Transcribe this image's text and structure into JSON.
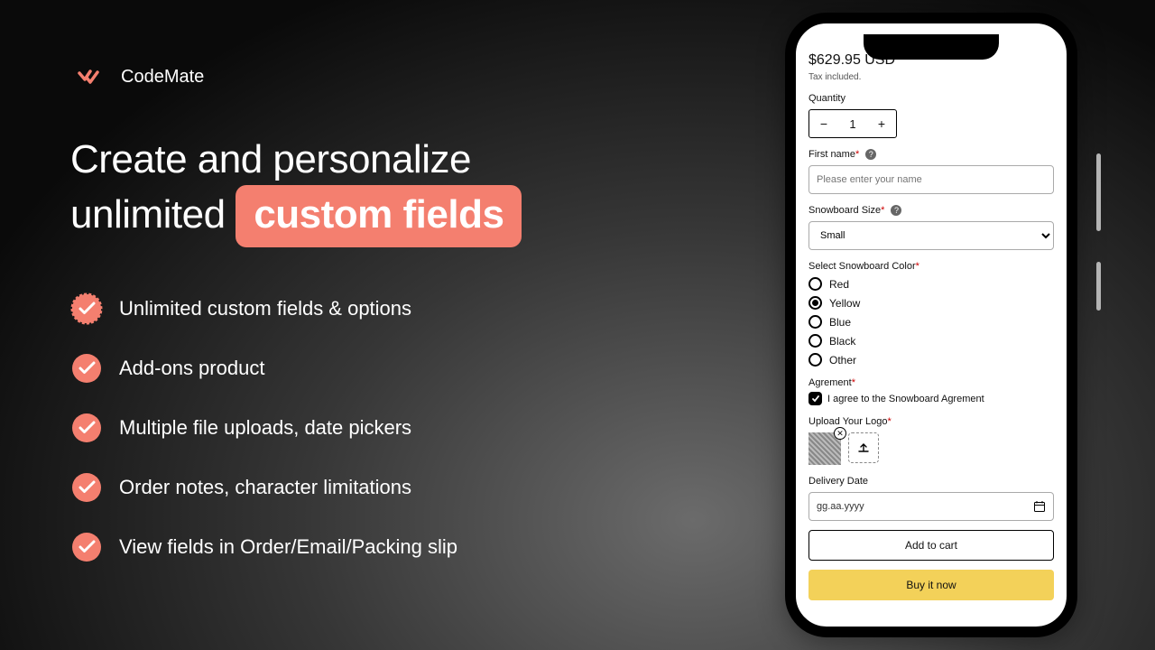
{
  "brand": {
    "name": "CodeMate"
  },
  "headline": {
    "line1": "Create and personalize",
    "line2_pre": "unlimited ",
    "highlight": "custom fields"
  },
  "features": [
    "Unlimited custom fields  & options",
    "Add-ons product",
    "Multiple file uploads, date pickers",
    "Order notes, character limitations",
    "View fields in Order/Email/Packing slip"
  ],
  "product": {
    "price": "$629.95 USD",
    "tax_note": "Tax included.",
    "quantity_label": "Quantity",
    "quantity_value": "1",
    "first_name": {
      "label": "First name",
      "placeholder": "Please enter your name"
    },
    "size": {
      "label": "Snowboard Size",
      "value": "Small"
    },
    "color": {
      "label": "Select Snowboard Color",
      "options": [
        "Red",
        "Yellow",
        "Blue",
        "Black",
        "Other"
      ],
      "selected": "Yellow"
    },
    "agreement": {
      "label": "Agrement",
      "text": "I agree to the Snowboard Agrement",
      "checked": true
    },
    "upload": {
      "label": "Upload Your Logo"
    },
    "delivery": {
      "label": "Delivery Date",
      "placeholder": "gg.aa.yyyy"
    },
    "add_to_cart": "Add to cart",
    "buy_now": "Buy it now"
  },
  "colors": {
    "accent": "#f47f6f",
    "buy": "#f3d159"
  }
}
